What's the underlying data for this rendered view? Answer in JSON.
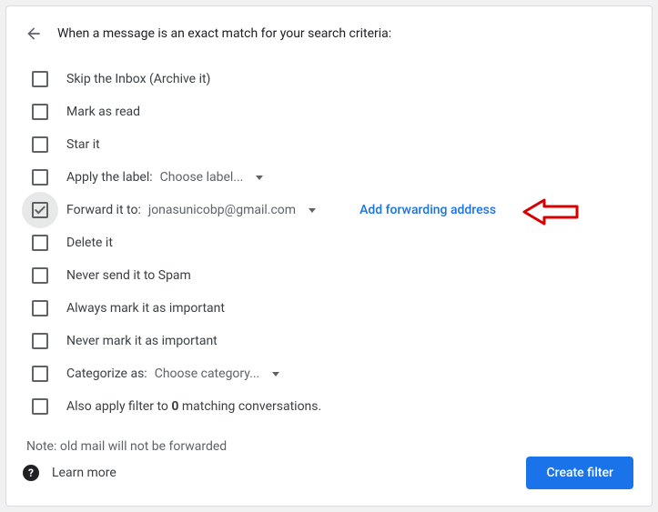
{
  "header": {
    "title": "When a message is an exact match for your search criteria:"
  },
  "options": {
    "skip_inbox": "Skip the Inbox (Archive it)",
    "mark_read": "Mark as read",
    "star_it": "Star it",
    "apply_label": "Apply the label:",
    "apply_label_choose": "Choose label...",
    "forward_to": "Forward it to:",
    "forward_email": "jonasunicobp@gmail.com",
    "add_forwarding": "Add forwarding address",
    "delete_it": "Delete it",
    "never_spam": "Never send it to Spam",
    "always_important": "Always mark it as important",
    "never_important": "Never mark it as important",
    "categorize_as": "Categorize as:",
    "categorize_choose": "Choose category...",
    "also_apply_pre": "Also apply filter to ",
    "also_apply_count": "0",
    "also_apply_post": " matching conversations."
  },
  "note": "Note: old mail will not be forwarded",
  "footer": {
    "learn_more": "Learn more",
    "create_filter": "Create filter"
  }
}
